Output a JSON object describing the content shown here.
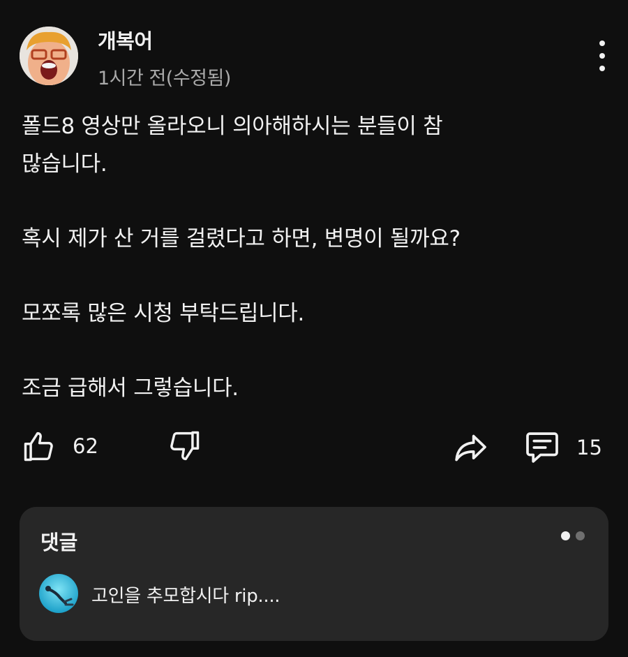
{
  "post": {
    "author": "개복어",
    "time": "1시간 전(수정됨)",
    "lines": [
      "폴드8 영상만 올라오니 의아해하시는 분들이 참",
      "많습니다.",
      "혹시 제가 산 거를 걸렸다고 하면, 변명이 될까요?",
      "모쪼록 많은 시청 부탁드립니다.",
      "조금 급해서 그렇습니다."
    ]
  },
  "actions": {
    "like_count": "62",
    "comment_count": "15",
    "like_icon": "thumb-up-icon",
    "dislike_icon": "thumb-down-icon",
    "share_icon": "share-icon",
    "comment_icon": "comment-icon"
  },
  "comments": {
    "title": "댓글",
    "top_comment": "고인을 추모합시다 rip...."
  },
  "colors": {
    "background": "#0f0f0f",
    "card": "#272727",
    "text": "#f1f1f1",
    "secondary": "#aaaaaa"
  }
}
